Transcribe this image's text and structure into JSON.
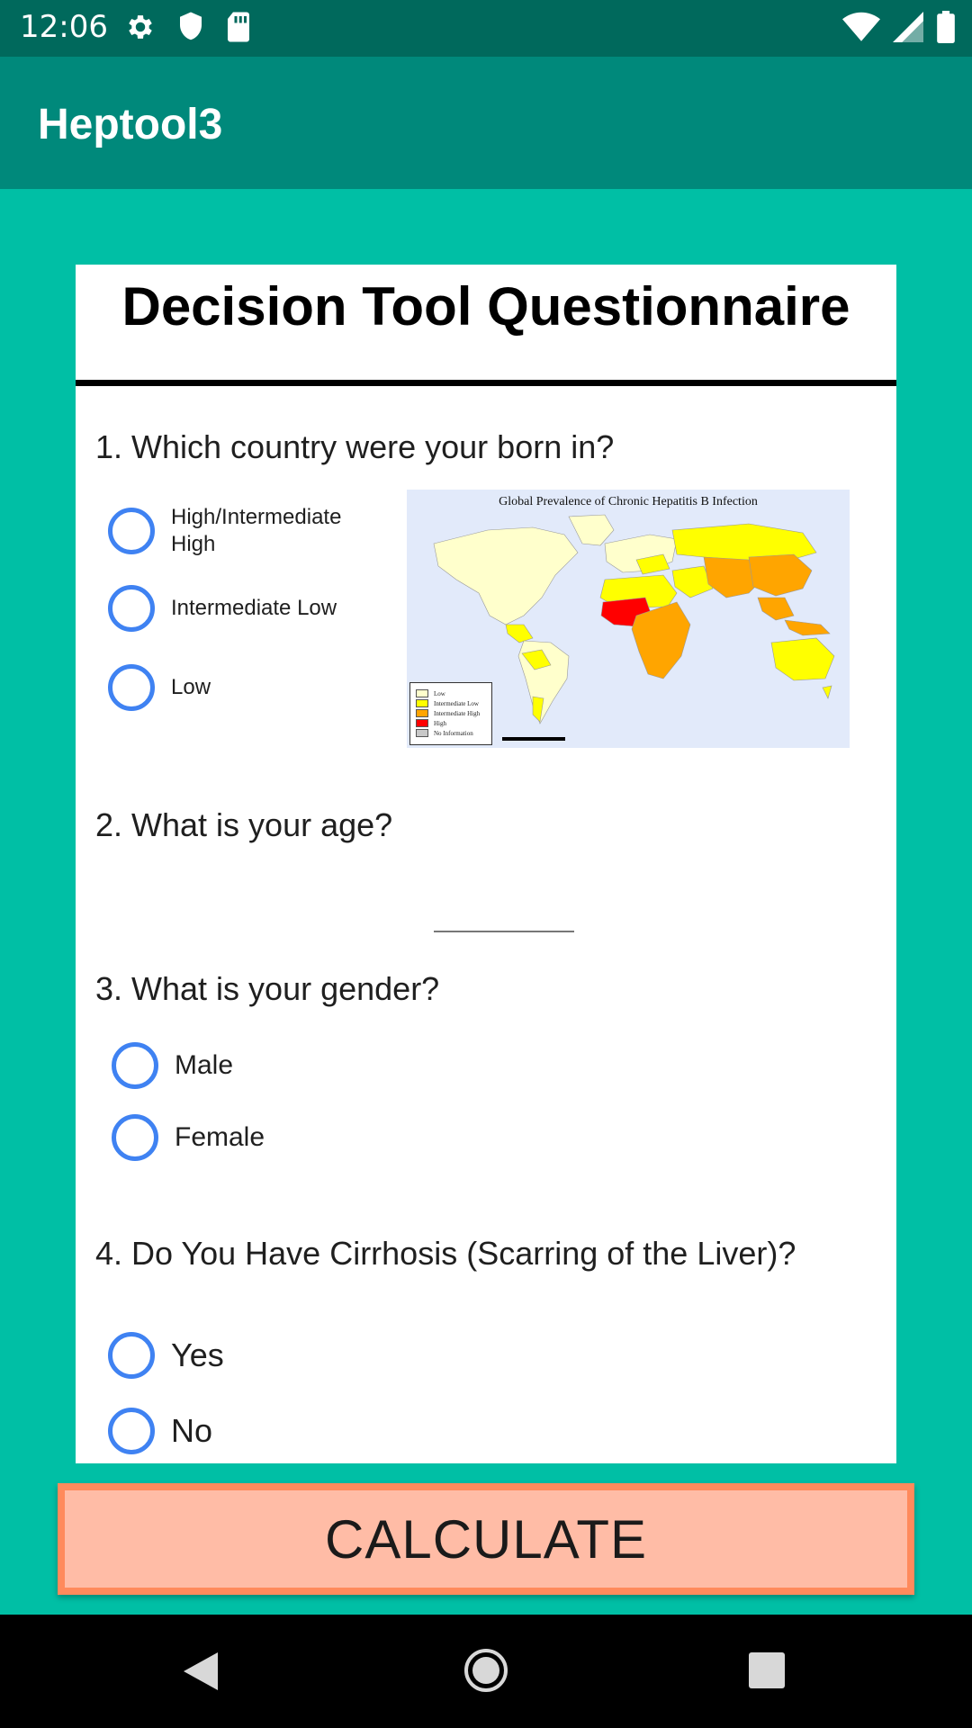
{
  "status_bar": {
    "time": "12:06",
    "left_icons": [
      "gear-icon",
      "shield-icon",
      "sd-card-icon"
    ],
    "right_icons": [
      "wifi-icon",
      "signal-icon",
      "battery-icon"
    ]
  },
  "app_bar": {
    "title": "Heptool3"
  },
  "form": {
    "title": "Decision Tool Questionnaire",
    "q1": {
      "text": "1. Which country were your born in?",
      "options": [
        "High/Intermediate High",
        "Intermediate Low",
        "Low"
      ],
      "map": {
        "title": "Global Prevalence of Chronic Hepatitis B Infection",
        "legend": [
          {
            "label": "Low",
            "color": "#FFFFCC"
          },
          {
            "label": "Intermediate Low",
            "color": "#FFFF00"
          },
          {
            "label": "Intermediate High",
            "color": "#FFA500"
          },
          {
            "label": "High",
            "color": "#FF0000"
          },
          {
            "label": "No Information",
            "color": "#C8C8C8"
          }
        ]
      }
    },
    "q2": {
      "text": "2. What is your age?",
      "value": ""
    },
    "q3": {
      "text": "3. What is your gender?",
      "options": [
        "Male",
        "Female"
      ]
    },
    "q4": {
      "text": "4. Do You Have Cirrhosis (Scarring of the Liver)?",
      "options": [
        "Yes",
        "No"
      ]
    }
  },
  "calculate_button": {
    "label": "CALCULATE"
  },
  "colors": {
    "status_bar": "#00695C",
    "app_bar": "#00897B",
    "background": "#00BFA5",
    "radio": "#3F82F2",
    "button_fill": "#FFBCA6",
    "button_border": "#FF8A5C"
  },
  "nav_bar": {
    "icons": [
      "back-icon",
      "home-icon",
      "recents-icon"
    ]
  }
}
